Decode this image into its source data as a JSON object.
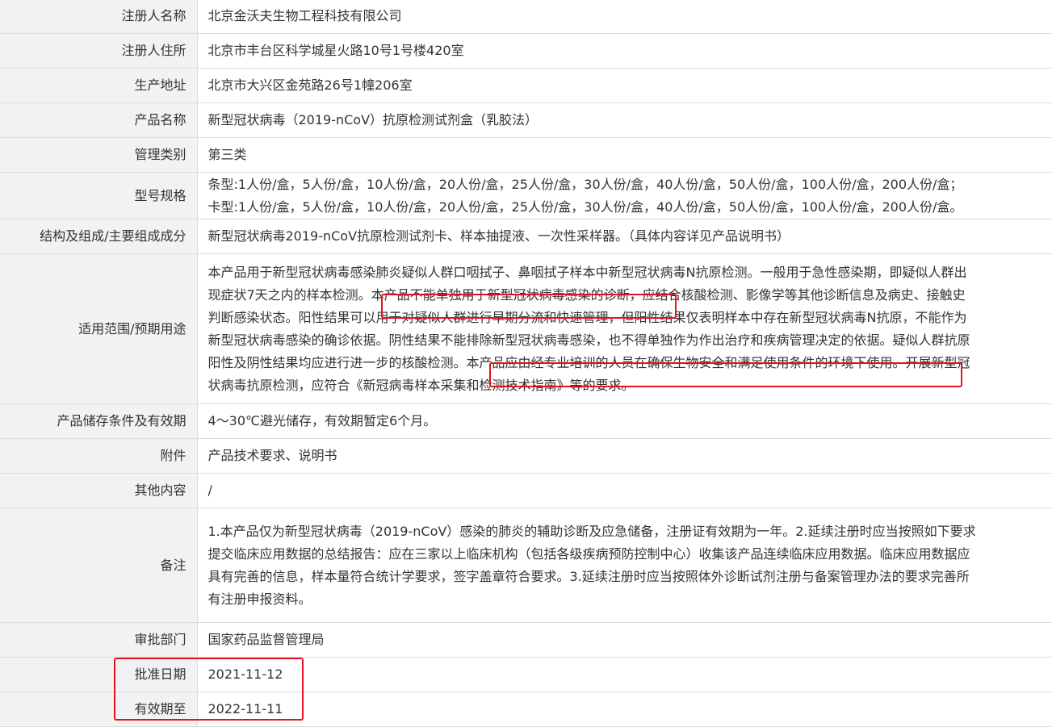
{
  "rows": [
    {
      "label": "注册人名称",
      "value": "北京金沃夫生物工程科技有限公司"
    },
    {
      "label": "注册人住所",
      "value": "北京市丰台区科学城星火路10号1号楼420室"
    },
    {
      "label": "生产地址",
      "value": "北京市大兴区金苑路26号1幢206室"
    },
    {
      "label": "产品名称",
      "value": "新型冠状病毒（2019-nCoV）抗原检测试剂盒（乳胶法）"
    },
    {
      "label": "管理类别",
      "value": "第三类"
    },
    {
      "label": "型号规格",
      "value_lines": [
        "条型:1人份/盒，5人份/盒，10人份/盒，20人份/盒，25人份/盒，30人份/盒，40人份/盒，50人份/盒，100人份/盒，200人份/盒；",
        "卡型:1人份/盒，5人份/盒，10人份/盒，20人份/盒，25人份/盒，30人份/盒，40人份/盒，50人份/盒，100人份/盒，200人份/盒。"
      ]
    },
    {
      "label": "结构及组成/主要组成成分",
      "value": "新型冠状病毒2019-nCoV抗原检测试剂卡、样本抽提液、一次性采样器。（具体内容详见产品说明书）"
    },
    {
      "label": "适用范围/预期用途",
      "value_lines": [
        "本产品用于新型冠状病毒感染肺炎疑似人群口咽拭子、鼻咽拭子样本中新型冠状病毒N抗原检测。一般用于急性感染期，即疑似人群出",
        "现症状7天之内的样本检测。本产品不能单独用于新型冠状病毒感染的诊断，应结合核酸检测、影像学等其他诊断信息及病史、接触史",
        "判断感染状态。阳性结果可以用于对疑似人群进行早期分流和快速管理，但阳性结果仅表明样本中存在新型冠状病毒N抗原，不能作为",
        "新型冠状病毒感染的确诊依据。阴性结果不能排除新型冠状病毒感染，也不得单独作为作出治疗和疾病管理决定的依据。疑似人群抗原",
        "阳性及阴性结果均应进行进一步的核酸检测。本产品应由经专业培训的人员在确保生物安全和满足使用条件的环境下使用。开展新型冠",
        "状病毒抗原检测，应符合《新冠病毒样本采集和检测技术指南》等的要求。"
      ]
    },
    {
      "label": "产品储存条件及有效期",
      "value": "4～30℃避光储存，有效期暂定6个月。"
    },
    {
      "label": "附件",
      "value": "产品技术要求、说明书"
    },
    {
      "label": "其他内容",
      "value": "/"
    },
    {
      "label": "备注",
      "value_lines": [
        "1.本产品仅为新型冠状病毒（2019-nCoV）感染的肺炎的辅助诊断及应急储备，注册证有效期为一年。2.延续注册时应当按照如下要求",
        "提交临床应用数据的总结报告：应在三家以上临床机构（包括各级疾病预防控制中心）收集该产品连续临床应用数据。临床应用数据应",
        "具有完善的信息，样本量符合统计学要求，签字盖章符合要求。3.延续注册时应当按照体外诊断试剂注册与备案管理办法的要求完善所",
        "有注册申报资料。"
      ]
    },
    {
      "label": "审批部门",
      "value": "国家药品监督管理局"
    },
    {
      "label": "批准日期",
      "value": "2021-11-12"
    },
    {
      "label": "有效期至",
      "value": "2022-11-11"
    }
  ],
  "highlight_color": "#e0141e"
}
